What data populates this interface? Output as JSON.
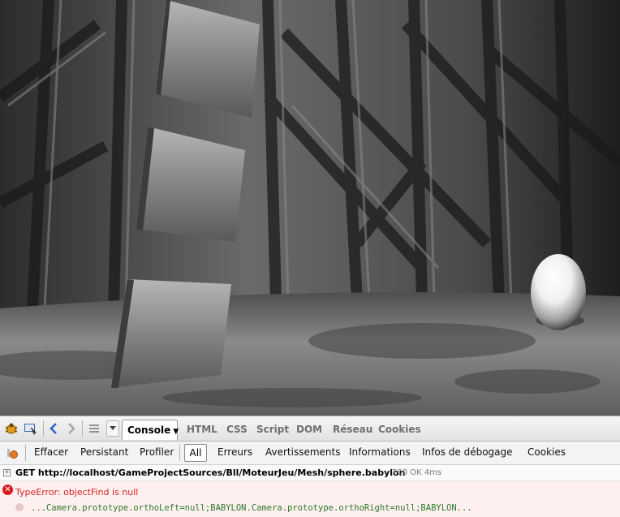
{
  "toolbar": {
    "icons": [
      "firebug-bug-icon",
      "inspect-icon",
      "back-icon",
      "forward-icon",
      "menu-icon",
      "dropdown-icon"
    ],
    "active_panel": "Console",
    "panels": [
      "HTML",
      "CSS",
      "Script",
      "DOM",
      "Réseau",
      "Cookies"
    ]
  },
  "console_toolbar": {
    "buttons": {
      "clear": "Effacer",
      "persist": "Persistant",
      "profile": "Profiler"
    },
    "filters": {
      "all": "All",
      "errors": "Erreurs",
      "warnings": "Avertissements",
      "info": "Informations",
      "debug": "Infos de débogage",
      "cookies": "Cookies"
    }
  },
  "log": {
    "request": {
      "expander": "+",
      "text": "GET http://localhost/GameProjectSources/Bll/MoteurJeu/Mesh/sphere.babylon",
      "status": "200 OK",
      "duration": "4ms"
    },
    "error": {
      "message": "TypeError: objectFind is null",
      "source": "...Camera.prototype.orthoLeft=null;BABYLON.Camera.prototype.orthoRight=null;BABYLON..."
    }
  },
  "colors": {
    "error_text": "#d42020",
    "error_background": "#fff0f0",
    "source_text": "#2a7a2a",
    "active_tab_background": "#ffffff"
  }
}
